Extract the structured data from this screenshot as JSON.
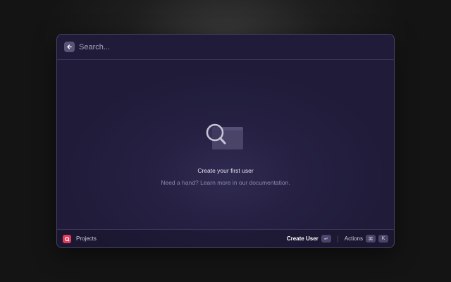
{
  "search": {
    "placeholder": "Search..."
  },
  "empty_state": {
    "title": "Create your first user",
    "hint": "Need a hand? Learn more in our documentation."
  },
  "footer": {
    "project_label": "Projects",
    "primary_action": "Create User",
    "primary_shortcut": "↵",
    "actions_label": "Actions",
    "actions_shortcut_modifier": "⌘",
    "actions_shortcut_key": "K"
  },
  "colors": {
    "window_background": "#262143",
    "brand": "#e23c5a",
    "text_primary": "#e6e3ef",
    "text_muted": "#8d88a6"
  },
  "icons": {
    "back": "arrow-left-icon",
    "empty": "magnifier-illustration-icon",
    "logo": "raycast-logo-icon"
  }
}
